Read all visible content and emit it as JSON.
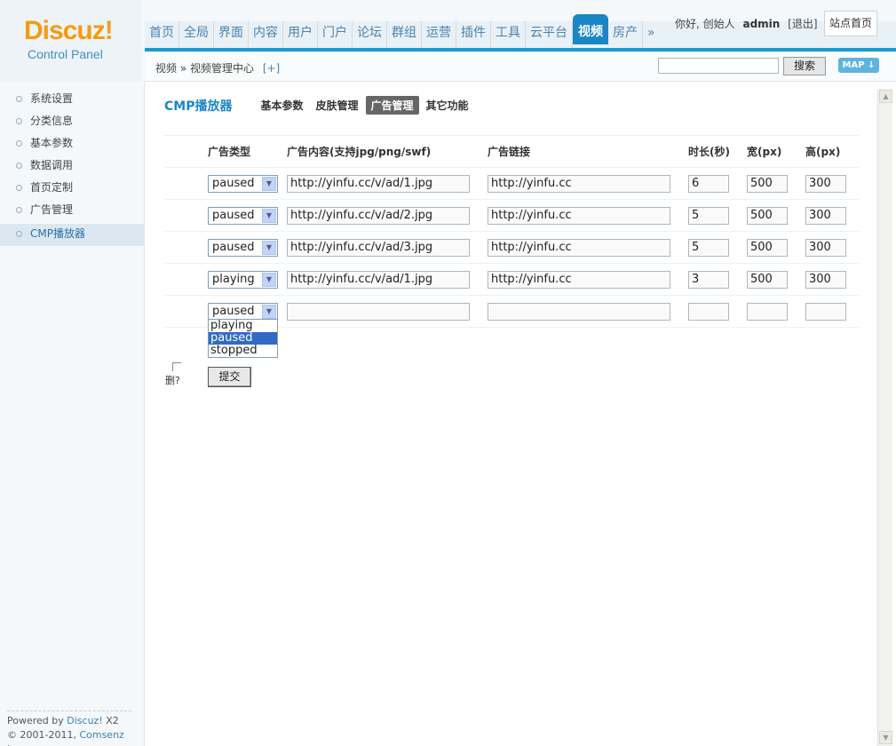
{
  "logo": {
    "brand": "Discuz",
    "brand_mark": "!",
    "subtitle": "Control Panel"
  },
  "nav": {
    "items": [
      "首页",
      "全局",
      "界面",
      "内容",
      "用户",
      "门户",
      "论坛",
      "群组",
      "运营",
      "插件",
      "工具",
      "云平台",
      "视频",
      "房产",
      "»"
    ],
    "active_index": 12
  },
  "user": {
    "greeting": "你好, 创始人",
    "name": "admin",
    "logout": "[退出]",
    "site_home": "站点首页"
  },
  "breadcrumb": {
    "text": "视频 » 视频管理中心",
    "add": "[+]"
  },
  "search": {
    "value": "",
    "button": "搜索",
    "map": "MAP ↓"
  },
  "sidebar": {
    "items": [
      "系统设置",
      "分类信息",
      "基本参数",
      "数据调用",
      "首页定制",
      "广告管理",
      "CMP播放器"
    ],
    "active_index": 6
  },
  "footer": {
    "line1_prefix": "Powered by ",
    "line1_link": "Discuz!",
    "line1_suffix": " X2",
    "line2_prefix": "© 2001-2011, ",
    "line2_link": "Comsenz Inc."
  },
  "page": {
    "title": "CMP播放器",
    "tabs": [
      "基本参数",
      "皮肤管理",
      "广告管理",
      "其它功能"
    ],
    "active_tab": 2
  },
  "table": {
    "headers": [
      "广告类型",
      "广告内容(支持jpg/png/swf)",
      "广告链接",
      "时长(秒)",
      "宽(px)",
      "高(px)"
    ],
    "rows": [
      {
        "type": "paused",
        "content": "http://yinfu.cc/v/ad/1.jpg",
        "link": "http://yinfu.cc",
        "duration": "6",
        "width": "500",
        "height": "300"
      },
      {
        "type": "paused",
        "content": "http://yinfu.cc/v/ad/2.jpg",
        "link": "http://yinfu.cc",
        "duration": "5",
        "width": "500",
        "height": "300"
      },
      {
        "type": "paused",
        "content": "http://yinfu.cc/v/ad/3.jpg",
        "link": "http://yinfu.cc",
        "duration": "5",
        "width": "500",
        "height": "300"
      },
      {
        "type": "playing",
        "content": "http://yinfu.cc/v/ad/1.jpg",
        "link": "http://yinfu.cc",
        "duration": "3",
        "width": "500",
        "height": "300"
      },
      {
        "type": "paused",
        "content": "",
        "link": "",
        "duration": "",
        "width": "",
        "height": ""
      }
    ],
    "dropdown_options": [
      "playing",
      "paused",
      "stopped"
    ],
    "dropdown_highlight": 1
  },
  "form": {
    "delete_label": "删?",
    "submit": "提交"
  }
}
